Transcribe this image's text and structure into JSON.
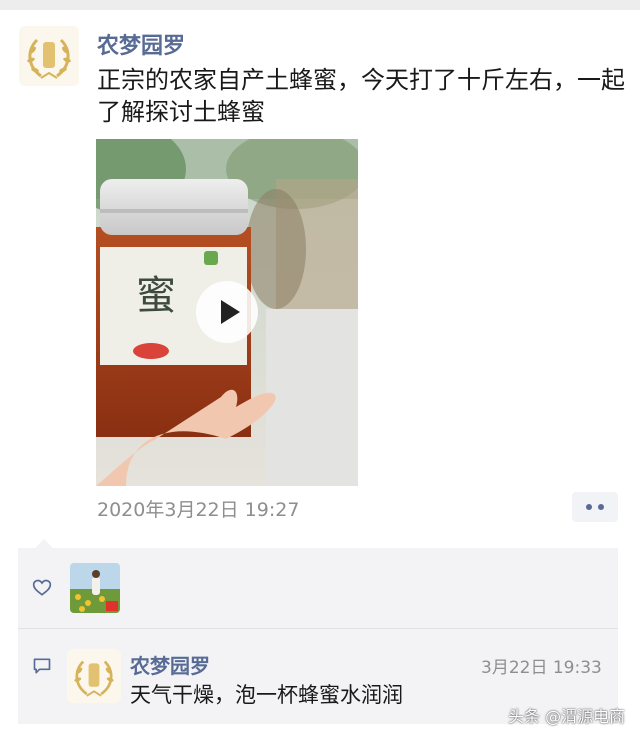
{
  "post": {
    "author": "农梦园罗",
    "text": "正宗的农家自产土蜂蜜，今天打了十斤左右，一起了解探讨土蜂蜜",
    "timestamp": "2020年3月22日 19:27",
    "media": {
      "type": "video",
      "icon": "play-icon"
    },
    "more_icon": "more-dots-icon"
  },
  "likes": {
    "icon": "heart-icon"
  },
  "comments": [
    {
      "author": "农梦园罗",
      "time": "3月22日 19:33",
      "text": "天气干燥，泡一杯蜂蜜水润润",
      "icon": "comment-icon"
    }
  ],
  "watermark": "头条 @渭源电商",
  "colors": {
    "name": "#576b95",
    "comment_bg": "#f3f3f5",
    "time": "#8e8e8e"
  }
}
